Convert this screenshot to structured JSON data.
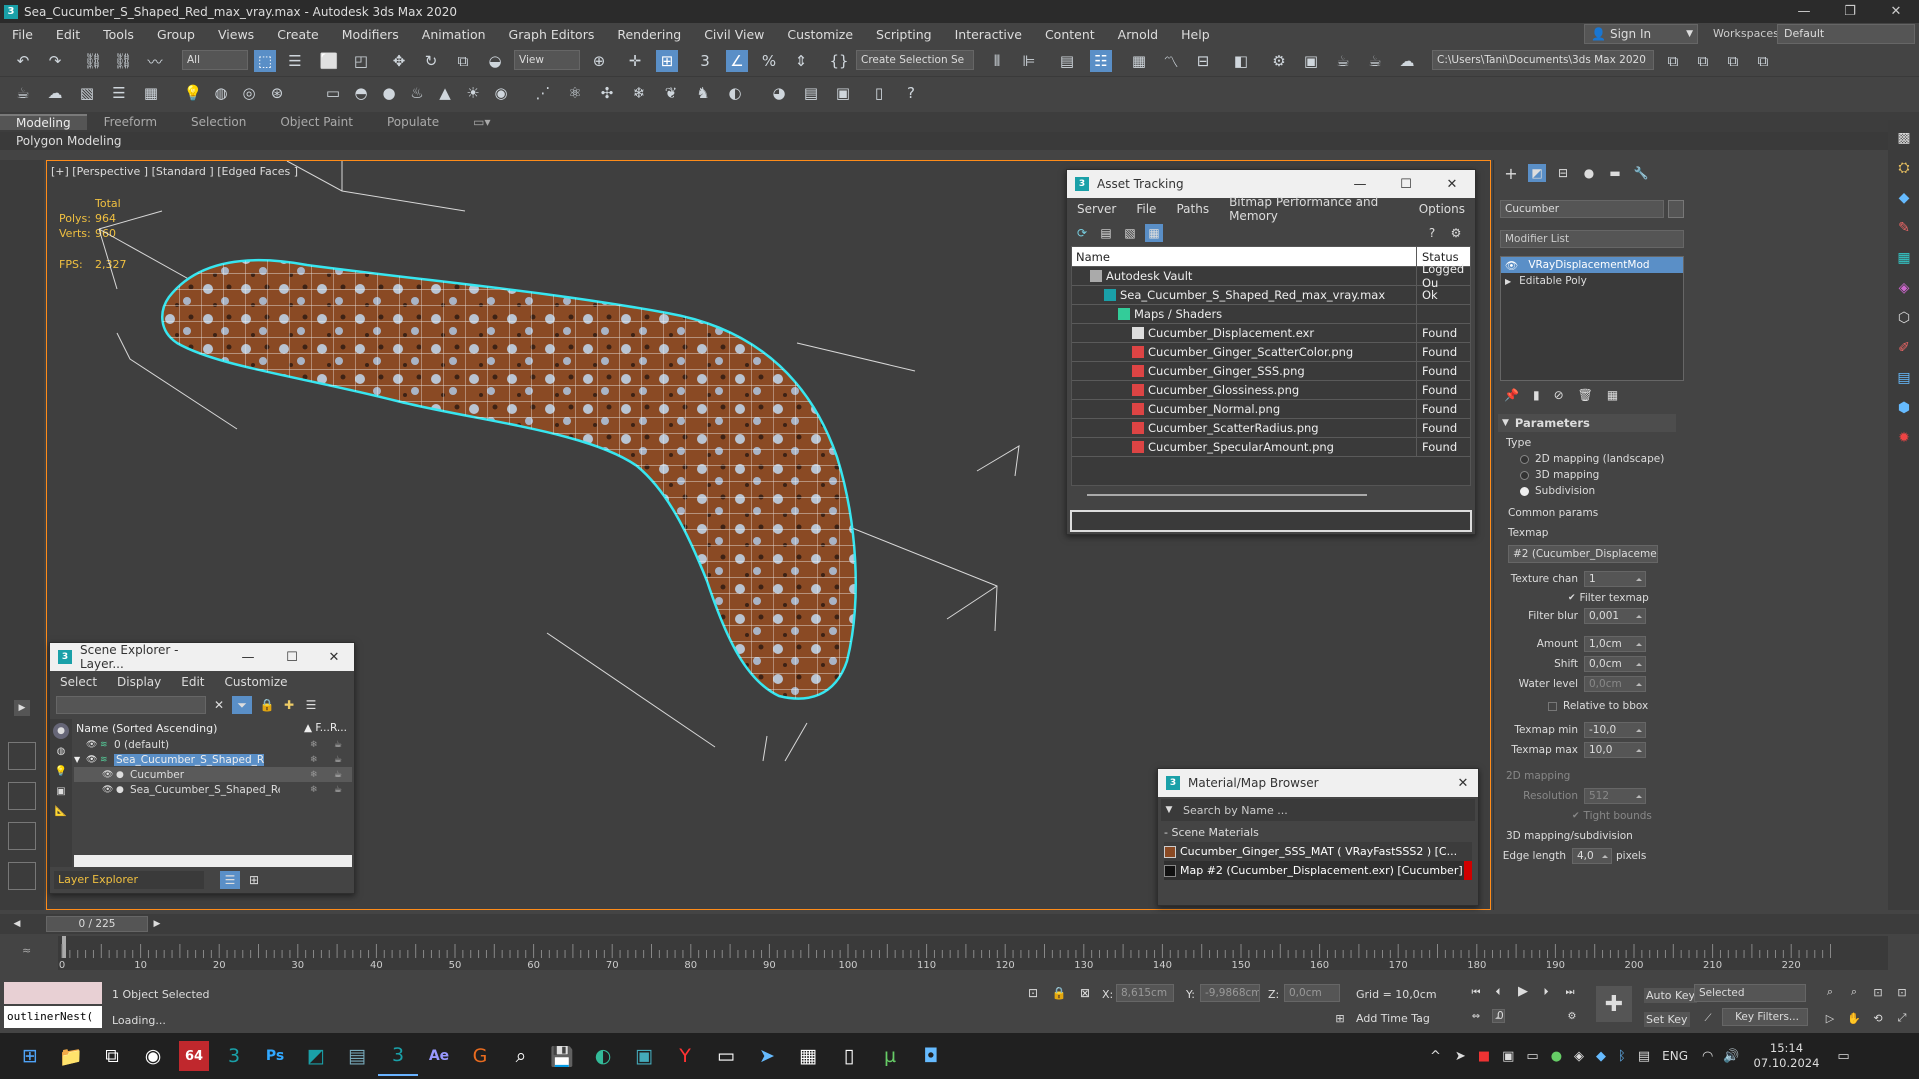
{
  "titlebar": {
    "title": "Sea_Cucumber_S_Shaped_Red_max_vray.max - Autodesk 3ds Max 2020",
    "minimize": "—",
    "maximize": "❐",
    "close": "✕"
  },
  "menu": [
    "File",
    "Edit",
    "Tools",
    "Group",
    "Views",
    "Create",
    "Modifiers",
    "Animation",
    "Graph Editors",
    "Rendering",
    "Civil View",
    "Customize",
    "Scripting",
    "Interactive",
    "Content",
    "Arnold",
    "Help"
  ],
  "signin": {
    "label": "Sign In"
  },
  "workspace": {
    "label": "Workspaces:",
    "value": "Default"
  },
  "toolbar": {
    "filter": "All",
    "view": "View",
    "selection_set": "Create Selection Se",
    "project_path": "C:\\Users\\Tani\\Documents\\3ds Max 2020"
  },
  "ribbon": {
    "tabs": [
      "Modeling",
      "Freeform",
      "Selection",
      "Object Paint",
      "Populate"
    ],
    "active_tab": "Modeling",
    "subtab": "Polygon Modeling"
  },
  "viewport": {
    "label": "[+] [Perspective ] [Standard ] [Edged Faces ]",
    "stats": {
      "total_label": "Total",
      "polys_label": "Polys:",
      "polys": "964",
      "verts_label": "Verts:",
      "verts": "960",
      "fps_label": "FPS:",
      "fps": "2,327"
    }
  },
  "asset_tracking": {
    "title": "Asset Tracking",
    "menu": [
      "Server",
      "File",
      "Paths",
      "Bitmap Performance and Memory",
      "Options"
    ],
    "col_name": "Name",
    "col_status": "Status",
    "rows": [
      {
        "name": "Autodesk Vault",
        "status": "Logged Ou",
        "indent": 1,
        "icon": "vault-icon"
      },
      {
        "name": "Sea_Cucumber_S_Shaped_Red_max_vray.max",
        "status": "Ok",
        "indent": 2,
        "icon": "max-file-icon"
      },
      {
        "name": "Maps / Shaders",
        "status": "",
        "indent": 3,
        "icon": "maps-icon"
      },
      {
        "name": "Cucumber_Displacement.exr",
        "status": "Found",
        "indent": 4,
        "icon": "exr-icon"
      },
      {
        "name": "Cucumber_Ginger_ScatterColor.png",
        "status": "Found",
        "indent": 4,
        "icon": "png-icon"
      },
      {
        "name": "Cucumber_Ginger_SSS.png",
        "status": "Found",
        "indent": 4,
        "icon": "png-icon"
      },
      {
        "name": "Cucumber_Glossiness.png",
        "status": "Found",
        "indent": 4,
        "icon": "png-icon"
      },
      {
        "name": "Cucumber_Normal.png",
        "status": "Found",
        "indent": 4,
        "icon": "png-icon"
      },
      {
        "name": "Cucumber_ScatterRadius.png",
        "status": "Found",
        "indent": 4,
        "icon": "png-icon"
      },
      {
        "name": "Cucumber_SpecularAmount.png",
        "status": "Found",
        "indent": 4,
        "icon": "png-icon"
      }
    ]
  },
  "scene_explorer": {
    "title": "Scene Explorer - Layer...",
    "menu": [
      "Select",
      "Display",
      "Edit",
      "Customize"
    ],
    "col_name": "Name (Sorted Ascending)",
    "col_f": "▲ F...",
    "col_r": "R...",
    "rows": [
      {
        "name": "0 (default)",
        "indent": 0
      },
      {
        "name": "Sea_Cucumber_S_Shaped_Red",
        "indent": 0
      },
      {
        "name": "Cucumber",
        "indent": 1
      },
      {
        "name": "Sea_Cucumber_S_Shaped_Red",
        "indent": 1
      }
    ],
    "footer": "Layer Explorer"
  },
  "material_browser": {
    "title": "Material/Map Browser",
    "search": "Search by Name ...",
    "group": "- Scene Materials",
    "items": [
      "Cucumber_Ginger_SSS_MAT  ( VRayFastSSS2 )  [C...",
      "Map #2 (Cucumber_Displacement.exr)  [Cucumber]"
    ]
  },
  "command_panel": {
    "object_name": "Cucumber",
    "modifier_list": "Modifier List",
    "stack": [
      "VRayDisplacementMod",
      "Editable Poly"
    ],
    "parameters": "Parameters",
    "type_label": "Type",
    "types": [
      "2D mapping (landscape)",
      "3D mapping",
      "Subdivision"
    ],
    "selected_type": "Subdivision",
    "common_params": "Common params",
    "texmap_label": "Texmap",
    "texmap_value": "#2 (Cucumber_Displacement.",
    "texture_chan_label": "Texture chan",
    "texture_chan": "1",
    "filter_texmap": "Filter texmap",
    "filter_blur_label": "Filter blur",
    "filter_blur": "0,001",
    "amount_label": "Amount",
    "amount": "1,0cm",
    "shift_label": "Shift",
    "shift": "0,0cm",
    "water_level_label": "Water level",
    "water_level": "0,0cm",
    "relative_bbox": "Relative to bbox",
    "texmap_min_label": "Texmap min",
    "texmap_min": "-10,0",
    "texmap_max_label": "Texmap max",
    "texmap_max": "10,0",
    "mapping_2d": "2D mapping",
    "resolution_label": "Resolution",
    "resolution": "512",
    "tight_bounds": "Tight bounds",
    "mapping_3d": "3D mapping/subdivision",
    "edge_length_label": "Edge length",
    "edge_length": "4,0",
    "pixels": "pixels"
  },
  "timeline": {
    "frame": "0 / 225",
    "ticks": [
      "0",
      "10",
      "20",
      "30",
      "40",
      "50",
      "60",
      "70",
      "80",
      "90",
      "100",
      "110",
      "120",
      "130",
      "140",
      "150",
      "160",
      "170",
      "180",
      "190",
      "200",
      "210",
      "220"
    ]
  },
  "status": {
    "selected": "1 Object Selected",
    "loading": "Loading...",
    "maxscript": "outlinerNest(",
    "x_label": "X:",
    "x": "8,615cm",
    "y_label": "Y:",
    "y": "-9,9868cm",
    "z_label": "Z:",
    "z": "0,0cm",
    "grid": "Grid = 10,0cm",
    "add_time_tag": "Add Time Tag",
    "auto_key": "Auto Key",
    "selected_sel": "Selected",
    "set_key": "Set Key",
    "key_filters": "Key Filters...",
    "frame_field": "0"
  },
  "taskbar": {
    "lang": "ENG",
    "time": "15:14",
    "date": "07.10.2024",
    "badge": "64"
  }
}
